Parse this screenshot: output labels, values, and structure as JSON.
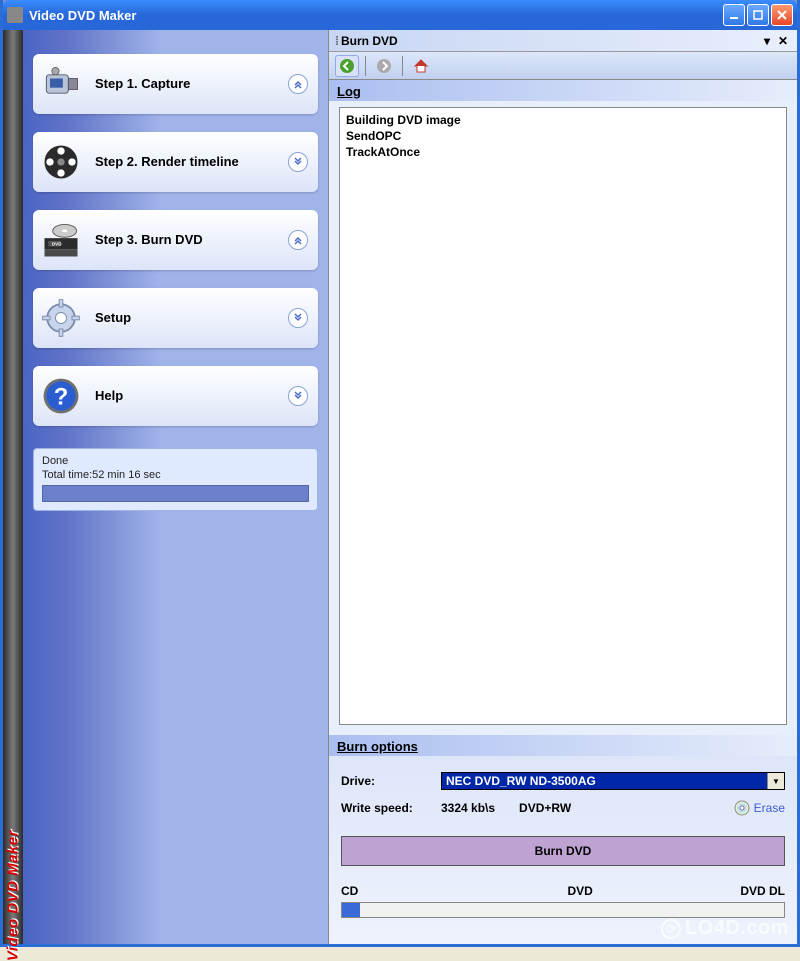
{
  "window": {
    "title": "Video DVD Maker"
  },
  "sidebar": {
    "vertical_text": "Video DVD Maker",
    "steps": [
      {
        "label": "Step 1. Capture",
        "expanded": true
      },
      {
        "label": "Step 2. Render timeline",
        "expanded": false
      },
      {
        "label": "Step 3. Burn DVD",
        "expanded": true
      },
      {
        "label": "Setup",
        "expanded": false
      },
      {
        "label": "Help",
        "expanded": false
      }
    ],
    "status": {
      "line1": "Done",
      "line2": "Total time:52 min 16 sec"
    }
  },
  "panel": {
    "title": "Burn DVD",
    "log_heading": "Log",
    "log_lines": "Building DVD image\nSendOPC\nTrackAtOnce",
    "burn_heading": "Burn options",
    "drive_label": "Drive:",
    "drive_value": "NEC    DVD_RW ND-3500AG",
    "write_speed_label": "Write speed:",
    "write_speed_value": "3324 kb\\s",
    "media_type": "DVD+RW",
    "erase_label": "Erase",
    "burn_button": "Burn DVD",
    "scale": {
      "cd": "CD",
      "dvd": "DVD",
      "dvddl": "DVD DL"
    }
  },
  "watermark": "LO4D.com"
}
